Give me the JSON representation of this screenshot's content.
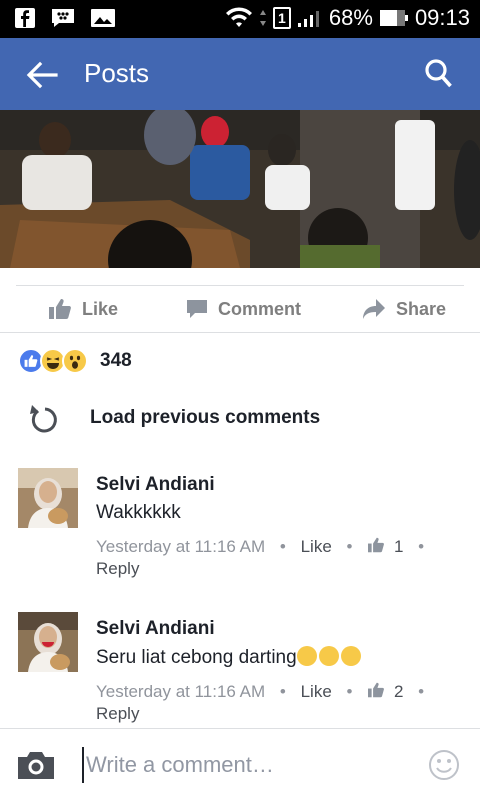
{
  "status_bar": {
    "battery": "68%",
    "time": "09:13",
    "sim": "1",
    "icons": [
      "facebook-icon",
      "bbm-icon",
      "gallery-icon",
      "wifi-icon",
      "sim-icon",
      "signal-icon",
      "battery-icon"
    ]
  },
  "app_bar": {
    "title": "Posts",
    "back_icon": "arrow-left-icon",
    "search_icon": "search-icon"
  },
  "actions": {
    "like": "Like",
    "comment": "Comment",
    "share": "Share"
  },
  "reactions": {
    "count": "348",
    "icons": [
      "like-reaction-icon",
      "haha-reaction-icon",
      "wow-reaction-icon"
    ]
  },
  "load_previous": "Load previous comments",
  "comments": [
    {
      "name": "Selvi Andiani",
      "text": "Wakkkkkk",
      "time": "Yesterday at 11:16 AM",
      "like_label": "Like",
      "likes": "1",
      "reply": "Reply"
    },
    {
      "name": "Selvi Andiani",
      "text": "Seru liat cebong darting",
      "time": "Yesterday at 11:16 AM",
      "like_label": "Like",
      "likes": "2",
      "reply": "Reply"
    }
  ],
  "composer": {
    "placeholder": "Write a comment…"
  },
  "colors": {
    "brand": "#4267b2",
    "meta_text": "#90949c",
    "action_text": "#7f7f7f"
  }
}
